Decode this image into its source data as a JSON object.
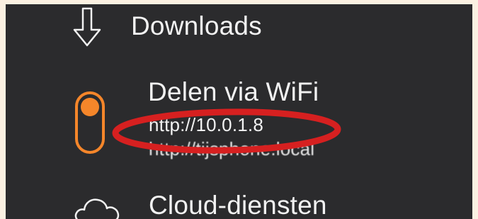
{
  "menu": {
    "downloads": {
      "label": "Downloads",
      "icon": "download-arrow-icon"
    },
    "wifi_sharing": {
      "label": "Delen via WiFi",
      "icon": "toggle-switch-icon",
      "toggle_state": "on",
      "url_ip": "http://10.0.1.8",
      "url_hostname": "http://tijsphone.local"
    },
    "cloud": {
      "label": "Cloud-diensten",
      "icon": "cloud-icon"
    }
  },
  "colors": {
    "background": "#2b2b2d",
    "text": "#f2f2f2",
    "accent": "#f5862a",
    "annotation": "#d62020",
    "frame": "#fbf1e2"
  }
}
